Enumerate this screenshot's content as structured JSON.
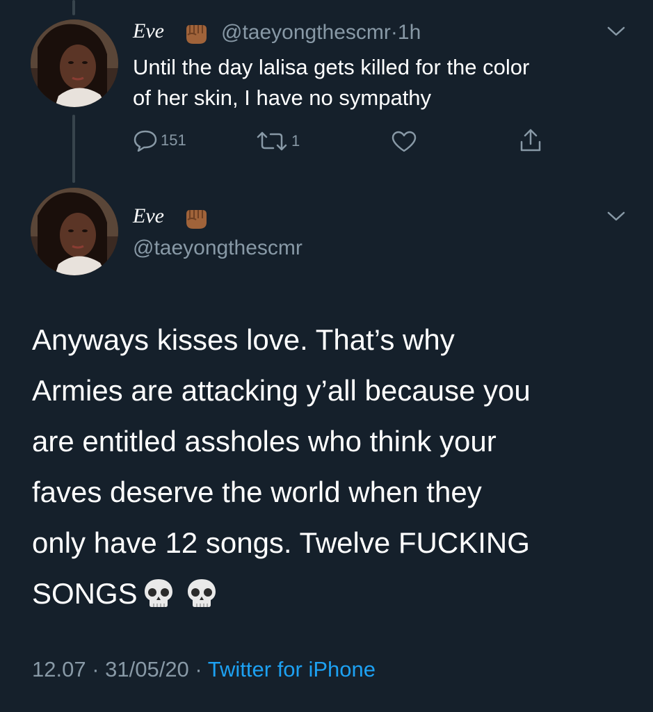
{
  "reply_tweet": {
    "display_name": "Eve",
    "name_emoji": "raised-fist-medium-dark-skin",
    "handle": "@taeyongthescmr",
    "separator": "·",
    "time": "1h",
    "text_line1": "Until the day lalisa gets killed for the color",
    "text_line2": "of her skin, I have no sympathy",
    "actions": {
      "reply_count": "151",
      "retweet_count": "1",
      "like_count": "",
      "share_label": ""
    }
  },
  "main_tweet": {
    "display_name": "Eve",
    "name_emoji": "raised-fist-medium-dark-skin",
    "handle": "@taeyongthescmr",
    "lines": [
      "Anyways kisses love. That’s why",
      "Armies are attacking y’all because you",
      "are entitled assholes who think your",
      "faves deserve the world when they",
      "only have 12 songs. Twelve FUCKING",
      "SONGS"
    ],
    "trailing_emojis": [
      "skull",
      "skull"
    ],
    "timestamp": "12.07 · 31/05/20 · ",
    "source": "Twitter for iPhone"
  },
  "colors": {
    "background": "#15202b",
    "text": "#ffffff",
    "secondary": "#8899a6",
    "link": "#1da1f2",
    "thread_line": "#38444d"
  }
}
